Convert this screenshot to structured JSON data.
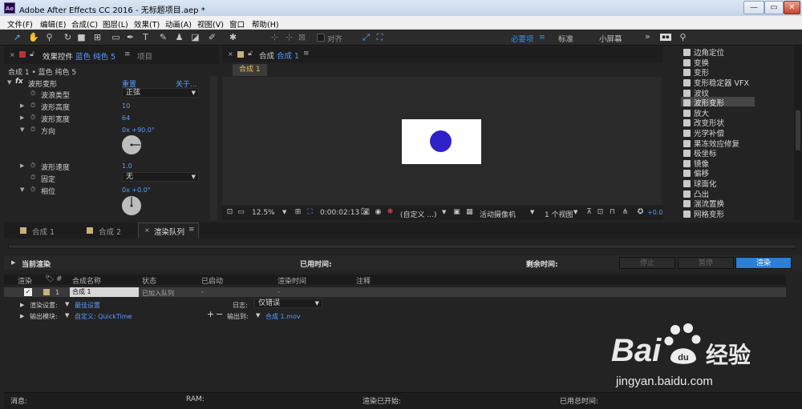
{
  "window": {
    "app_badge": "Ae",
    "title": "Adobe After Effects CC 2016 - 无标题项目.aep *",
    "controls": [
      "—",
      "▭",
      "✕"
    ]
  },
  "menu": [
    "文件(F)",
    "编辑(E)",
    "合成(C)",
    "图层(L)",
    "效果(T)",
    "动画(A)",
    "视图(V)",
    "窗口",
    "帮助(H)"
  ],
  "toolbar": {
    "snap_label": "对齐",
    "workspaces": [
      "必要项",
      "标准",
      "小屏幕"
    ],
    "overflow": "»"
  },
  "effects_panel": {
    "tab_label": "效果控件",
    "tab_layer": "蓝色 纯色 5",
    "tab_menu": "≡",
    "project_tab": "项目",
    "subtitle": "合成 1 • 蓝色 纯色 5",
    "effect_name": "波形变形",
    "reset": "重置",
    "about": "关于...",
    "fx": "fx",
    "props": [
      {
        "label": "波浪类型",
        "value": "正弦"
      },
      {
        "label": "波形高度",
        "value": "10"
      },
      {
        "label": "波形宽度",
        "value": "64"
      },
      {
        "label": "方向",
        "value": "0x +90.0°"
      },
      {
        "label": "波形速度",
        "value": "1.0"
      },
      {
        "label": "固定",
        "value": "无"
      },
      {
        "label": "相位",
        "value": "0x +0.0°"
      }
    ]
  },
  "comp_panel": {
    "tab_prefix": "合成",
    "tab_name": "合成 1",
    "tab_menu": "≡",
    "breadcrumb": "合成 1",
    "zoom": "12.5%",
    "timecode": "0:00:02:13",
    "resolution": "(自定义 ...)",
    "camera": "活动摄像机",
    "views": "1 个视图",
    "exposure": "+0.0",
    "solid_color": "#ffffff",
    "circle_color": "#2f22c8"
  },
  "effects_list": {
    "items": [
      "边角定位",
      "变换",
      "变形",
      "变形稳定器 VFX",
      "波纹",
      "波形变形",
      "放大",
      "改变形状",
      "光学补偿",
      "果冻效应修复",
      "极坐标",
      "镜像",
      "偏移",
      "球面化",
      "凸出",
      "湍流置换",
      "网格变形"
    ],
    "selected": "波形变形"
  },
  "bottom_tabs": [
    {
      "label": "合成 1",
      "active": false
    },
    {
      "label": "合成 2",
      "active": false
    },
    {
      "label": "渲染队列",
      "active": true
    }
  ],
  "close_x": "×",
  "render_queue": {
    "current_render": "当前渲染",
    "elapsed_label": "已用时间:",
    "remaining_label": "剩余时间:",
    "stop": "停止",
    "pause": "暂停",
    "render": "渲染",
    "columns": [
      "渲染",
      "#",
      "合成名称",
      "状态",
      "已启动",
      "渲染时间",
      "注释"
    ],
    "item": {
      "number": "1",
      "comp": "合成 1",
      "status": "已加入队列",
      "started": "-",
      "render_time": "-",
      "render_settings_label": "渲染设置:",
      "render_settings_value": "最佳设置",
      "log_label": "日志:",
      "log_value": "仅错误",
      "output_module_label": "输出模块:",
      "output_module_value": "自定义: QuickTime",
      "output_to_label": "输出到:",
      "output_to_value": "合成 1.mov",
      "plus": "+",
      "minus": "−"
    }
  },
  "status_bar": {
    "message": "消息:",
    "ram": "RAM:",
    "render_started": "渲染已开始:",
    "total_time": "已用总时间:"
  },
  "watermark": {
    "brand": "Bai",
    "brand2": "经验",
    "url": "jingyan.baidu.com"
  }
}
